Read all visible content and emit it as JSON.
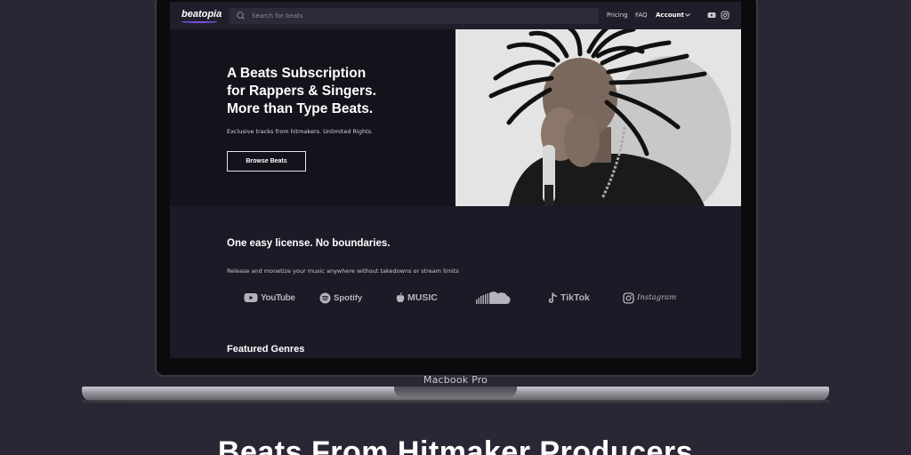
{
  "site": {
    "logo": "beatopia",
    "search_placeholder": "Search for beats",
    "nav": {
      "pricing": "Pricing",
      "faq": "FAQ",
      "account": "Account"
    }
  },
  "hero": {
    "title_line1": "A Beats Subscription",
    "title_line2": "for Rappers & Singers.",
    "title_line3": "More than Type Beats.",
    "subtitle": "Exclusive tracks from hitmakers. Unlimited Rights.",
    "button": "Browse Beats"
  },
  "license": {
    "title": "One easy license. No boundaries.",
    "subtitle": "Release and monetize your music anywhere without takedowns or stream limits",
    "platforms": {
      "youtube": "YouTube",
      "spotify": "Spotify",
      "apple_music": "MUSIC",
      "tiktok": "TikTok",
      "instagram": "Instagram"
    }
  },
  "featured_genres": "Featured Genres",
  "device_label": "Macbook Pro",
  "page_headline": "Beats From Hitmaker Producers",
  "icons": [
    "search-icon",
    "chevron-down-icon",
    "youtube-icon",
    "instagram-icon",
    "spotify-icon",
    "apple-icon",
    "soundcloud-icon",
    "tiktok-icon"
  ],
  "colors": {
    "page_bg": "#2b2634",
    "site_bg": "#1c1a26",
    "hero_bg": "#14121b",
    "accent": "#7b4fd9"
  }
}
